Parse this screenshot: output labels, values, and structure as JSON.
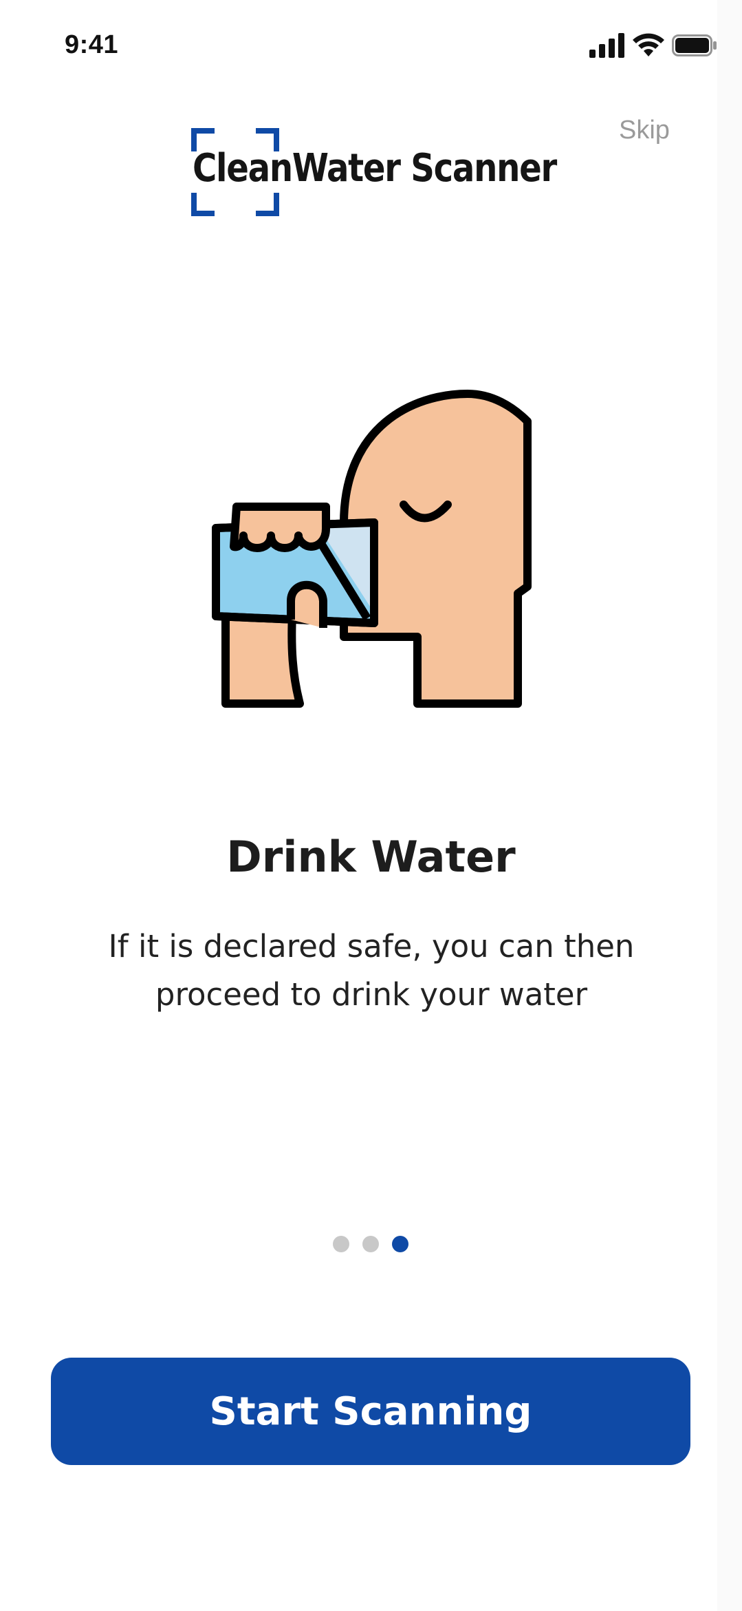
{
  "status_bar": {
    "time": "9:41",
    "icons": [
      "cellular-signal-icon",
      "wifi-icon",
      "battery-icon"
    ]
  },
  "header": {
    "app_name": "CleanWater Scanner",
    "logo_icon": "scan-frame-icon",
    "skip_label": "Skip"
  },
  "onboarding": {
    "illustration": "person-drinking-water-illustration",
    "title": "Drink Water",
    "description": "If it is declared safe, you can then proceed to drink your water",
    "pagination": {
      "total_pages": 3,
      "current_page": 3
    }
  },
  "primary_action": {
    "label": "Start Scanning"
  },
  "colors": {
    "accent": "#0F4AA6",
    "inactive_dot": "#C8C8C8",
    "skin": "#F6C29B",
    "water": "#8ED0EE",
    "glass_light": "#CFE3F1",
    "outline": "#000000",
    "skip_text": "#9A9A9A"
  }
}
